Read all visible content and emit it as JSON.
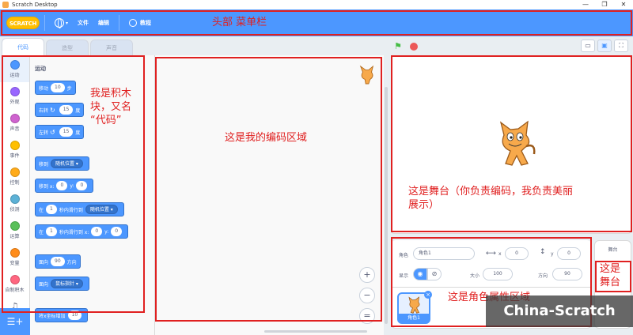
{
  "window": {
    "title": "Scratch Desktop",
    "minimize": "—",
    "restore": "❐",
    "close": "✕"
  },
  "menu": {
    "logo": "SCRATCH",
    "file": "文件",
    "edit": "编辑",
    "tutorials": "教程",
    "language_caret": "▾"
  },
  "tabs": {
    "code": "代码",
    "costumes": "造型",
    "sounds": "声音"
  },
  "categories": [
    {
      "label": "运动",
      "color": "#4c97ff"
    },
    {
      "label": "外观",
      "color": "#9966ff"
    },
    {
      "label": "声音",
      "color": "#cf63cf"
    },
    {
      "label": "事件",
      "color": "#ffbf00"
    },
    {
      "label": "控制",
      "color": "#ffab19"
    },
    {
      "label": "侦测",
      "color": "#5cb1d6"
    },
    {
      "label": "运算",
      "color": "#59c059"
    },
    {
      "label": "变量",
      "color": "#ff8c1a"
    },
    {
      "label": "自制积木",
      "color": "#ff6680"
    },
    {
      "label": "音乐",
      "color": ""
    }
  ],
  "palette": {
    "heading": "运动",
    "move": {
      "a": "移动",
      "v": "10",
      "b": "步"
    },
    "turn_right": {
      "a": "右转",
      "icon": "↻",
      "v": "15",
      "b": "度"
    },
    "turn_left": {
      "a": "左转",
      "icon": "↺",
      "v": "15",
      "b": "度"
    },
    "goto": {
      "a": "移到",
      "d": "随机位置 ▾"
    },
    "goto_xy": {
      "a": "移到 x:",
      "x": "0",
      "b": "y:",
      "y": "0"
    },
    "glide": {
      "a": "在",
      "v": "1",
      "b": "秒内滑行到",
      "d": "随机位置 ▾"
    },
    "glide_xy": {
      "a": "在",
      "v": "1",
      "b": "秒内滑行到 x:",
      "x": "0",
      "c": "y:",
      "y": "0"
    },
    "point_dir": {
      "a": "面向",
      "v": "90",
      "b": "方向"
    },
    "point_towards": {
      "a": "面向",
      "d": "鼠标指针 ▾"
    },
    "change_x": {
      "a": "将x坐标增加",
      "v": "10"
    }
  },
  "zoom": {
    "in": "+",
    "out": "−",
    "reset": "="
  },
  "stage_controls": {
    "flag": "⚑",
    "small": "▭",
    "normal": "▣",
    "full": "⛶"
  },
  "sprite_info": {
    "sprite_label": "角色",
    "sprite_name": "角色1",
    "x_label": "x",
    "x_value": "0",
    "y_label": "y",
    "y_value": "0",
    "show_label": "显示",
    "size_label": "大小",
    "size_value": "100",
    "direction_label": "方向",
    "direction_value": "90",
    "tile_label": "角色1",
    "tile_close": "×"
  },
  "stage_column": {
    "label": "舞台"
  },
  "annotations": {
    "menubar": "头部 菜单栏",
    "blocks": "我是积木\n块，又名\n“代码”",
    "code": "这是我的编码区域",
    "stage": "这是舞台（你负责编码，我负责美丽\n展示）",
    "sprite": "这是角色属性区域",
    "stage_col": "这是\n舞台"
  },
  "watermark": "China-Scratch"
}
